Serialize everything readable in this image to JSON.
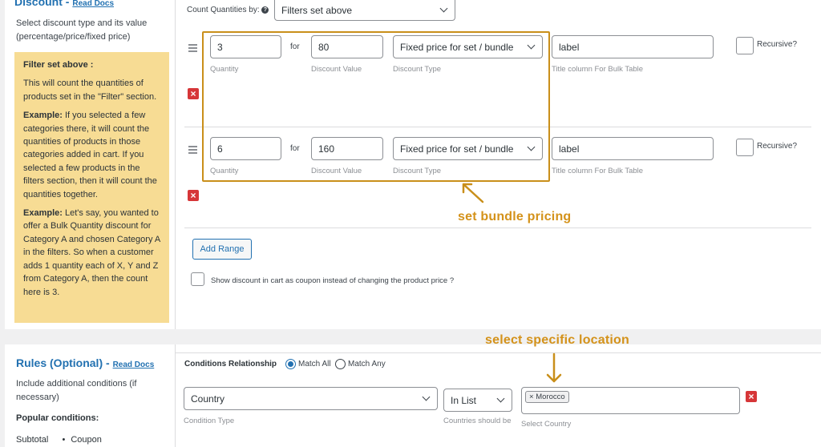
{
  "discount_section": {
    "title": "Discount",
    "separator": " - ",
    "read_docs": "Read Docs",
    "description": "Select discount type and its value (percentage/price/fixed price)",
    "note": {
      "heading": "Filter set above :",
      "para1": "This will count the quantities of products set in the \"Filter\" section.",
      "example1_label": "Example:",
      "example1_text": " If you selected a few categories there, it will count the quantities of products in those categories added in cart. If you selected a few products in the filters section, then it will count the quantities together.",
      "example2_label": "Example:",
      "example2_text": " Let's say, you wanted to offer a Bulk Quantity discount for Category A and chosen Category A in the filters. So when a customer adds 1 quantity each of X, Y and Z from Category A, then the count here is 3."
    }
  },
  "count_quantities": {
    "label": "Count Quantities by:",
    "help_icon": "question-circle-icon",
    "value": "Filters set above"
  },
  "ranges": [
    {
      "quantity": "3",
      "for_label": "for",
      "discount_value": "80",
      "discount_type": "Fixed price for set / bundle",
      "title": "label",
      "recursive_label": "Recursive?"
    },
    {
      "quantity": "6",
      "for_label": "for",
      "discount_value": "160",
      "discount_type": "Fixed price for set / bundle",
      "title": "label",
      "recursive_label": "Recursive?"
    }
  ],
  "range_sublabels": {
    "quantity": "Quantity",
    "discount_value": "Discount Value",
    "discount_type": "Discount Type",
    "title": "Title column For Bulk Table"
  },
  "add_range_label": "Add Range",
  "coupon_option_label": "Show discount in cart as coupon instead of changing the product price ?",
  "annotations": {
    "bundle": "set bundle pricing",
    "location": "select specific location"
  },
  "rules_section": {
    "title": "Rules (Optional)",
    "separator": " - ",
    "read_docs": "Read Docs",
    "description": "Include additional conditions (if necessary)",
    "popular_heading": "Popular conditions:",
    "popular_items": [
      "Subtotal",
      "Coupon"
    ]
  },
  "conditions": {
    "relationship_label": "Conditions Relationship",
    "match_all": "Match All",
    "match_any": "Match Any",
    "selected": "match_all",
    "condition_type": "Country",
    "condition_type_sublabel": "Condition Type",
    "operator": "In List",
    "operator_sublabel": "Countries should be",
    "value_tag": "Morocco",
    "value_tag_remove": "×",
    "value_sublabel": "Select Country"
  },
  "colors": {
    "accent": "#2271b1",
    "annotation": "#d4921a",
    "note_bg": "#f7dc94",
    "danger": "#d63638"
  }
}
